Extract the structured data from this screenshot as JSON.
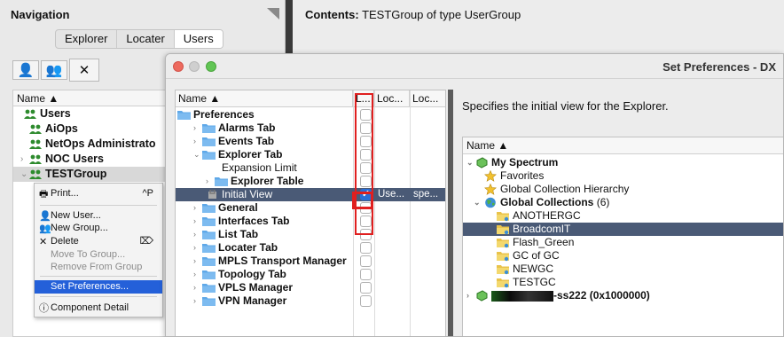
{
  "navigation": {
    "title": "Navigation",
    "tabs": [
      "Explorer",
      "Locater",
      "Users"
    ],
    "active_tab": "Users",
    "tree_header": "Name ▲",
    "items": [
      {
        "label": "Users",
        "indent": 0,
        "arrow": "",
        "selected": false
      },
      {
        "label": "AiOps",
        "indent": 1,
        "arrow": "",
        "selected": false
      },
      {
        "label": "NetOps Administrato",
        "indent": 1,
        "arrow": "",
        "selected": false
      },
      {
        "label": "NOC Users",
        "indent": 1,
        "arrow": "›",
        "selected": false
      },
      {
        "label": "TESTGroup",
        "indent": 1,
        "arrow": "⌄",
        "selected": true
      }
    ]
  },
  "context_menu": {
    "items": [
      {
        "label": "Print...",
        "shortcut": "^P",
        "icon": "printer-icon",
        "enabled": true,
        "highlighted": false
      },
      {
        "label": "New User...",
        "shortcut": "",
        "icon": "user-icon",
        "enabled": true,
        "highlighted": false
      },
      {
        "label": "New Group...",
        "shortcut": "",
        "icon": "group-icon",
        "enabled": true,
        "highlighted": false
      },
      {
        "label": "Delete",
        "shortcut": "⌦",
        "icon": "delete-icon",
        "enabled": true,
        "highlighted": false
      },
      {
        "label": "Move To Group...",
        "shortcut": "",
        "icon": "",
        "enabled": false,
        "highlighted": false
      },
      {
        "label": "Remove From Group",
        "shortcut": "",
        "icon": "",
        "enabled": false,
        "highlighted": false
      },
      {
        "label": "Set Preferences...",
        "shortcut": "",
        "icon": "",
        "enabled": true,
        "highlighted": true
      },
      {
        "label": "Component Detail",
        "shortcut": "",
        "icon": "info-icon",
        "enabled": true,
        "highlighted": false
      }
    ]
  },
  "contents": {
    "label": "Contents:",
    "value": "TESTGroup of type UserGroup"
  },
  "dialog": {
    "title": "Set Preferences - DX",
    "table_headers": [
      "Name ▲",
      "L...",
      "Loc...",
      "Loc..."
    ],
    "rows": [
      {
        "label": "Preferences",
        "level": 0,
        "arrow": "",
        "folder": true,
        "leaf": false,
        "checked": false,
        "loc": "",
        "loc2": "",
        "selected": false
      },
      {
        "label": "Alarms Tab",
        "level": 1,
        "arrow": "›",
        "folder": true,
        "leaf": false,
        "checked": false,
        "loc": "",
        "loc2": "",
        "selected": false
      },
      {
        "label": "Events Tab",
        "level": 1,
        "arrow": "›",
        "folder": true,
        "leaf": false,
        "checked": false,
        "loc": "",
        "loc2": "",
        "selected": false
      },
      {
        "label": "Explorer Tab",
        "level": 1,
        "arrow": "⌄",
        "folder": true,
        "leaf": false,
        "checked": false,
        "loc": "",
        "loc2": "",
        "selected": false
      },
      {
        "label": "Expansion Limit",
        "level": 2,
        "arrow": "",
        "folder": false,
        "leaf": true,
        "checked": false,
        "loc": "",
        "loc2": "",
        "selected": false
      },
      {
        "label": "Explorer Table",
        "level": 2,
        "arrow": "›",
        "folder": true,
        "leaf": false,
        "checked": false,
        "loc": "",
        "loc2": "",
        "selected": false
      },
      {
        "label": "Initial View",
        "level": 2,
        "arrow": "",
        "folder": false,
        "leaf": true,
        "checked": true,
        "loc": "Use...",
        "loc2": "spe...",
        "selected": true
      },
      {
        "label": "General",
        "level": 1,
        "arrow": "›",
        "folder": true,
        "leaf": false,
        "checked": false,
        "loc": "",
        "loc2": "",
        "selected": false
      },
      {
        "label": "Interfaces Tab",
        "level": 1,
        "arrow": "›",
        "folder": true,
        "leaf": false,
        "checked": false,
        "loc": "",
        "loc2": "",
        "selected": false
      },
      {
        "label": "List Tab",
        "level": 1,
        "arrow": "›",
        "folder": true,
        "leaf": false,
        "checked": false,
        "loc": "",
        "loc2": "",
        "selected": false
      },
      {
        "label": "Locater Tab",
        "level": 1,
        "arrow": "›",
        "folder": true,
        "leaf": false,
        "checked": false,
        "loc": "",
        "loc2": "",
        "selected": false
      },
      {
        "label": "MPLS Transport Manager",
        "level": 1,
        "arrow": "›",
        "folder": true,
        "leaf": false,
        "checked": false,
        "loc": "",
        "loc2": "",
        "selected": false
      },
      {
        "label": "Topology Tab",
        "level": 1,
        "arrow": "›",
        "folder": true,
        "leaf": false,
        "checked": false,
        "loc": "",
        "loc2": "",
        "selected": false
      },
      {
        "label": "VPLS Manager",
        "level": 1,
        "arrow": "›",
        "folder": true,
        "leaf": false,
        "checked": false,
        "loc": "",
        "loc2": "",
        "selected": false
      },
      {
        "label": "VPN Manager",
        "level": 1,
        "arrow": "›",
        "folder": true,
        "leaf": false,
        "checked": false,
        "loc": "",
        "loc2": "",
        "selected": false
      }
    ],
    "description": "Specifies the initial view for the Explorer.",
    "view_tree_header": "Name ▲",
    "view_tree": [
      {
        "label": "My Spectrum",
        "level": 0,
        "arrow": "⌄",
        "icon": "spectrum",
        "bold": true,
        "selected": false
      },
      {
        "label": "Favorites",
        "level": 1,
        "arrow": "",
        "icon": "star",
        "bold": false,
        "selected": false
      },
      {
        "label": "Global Collection Hierarchy",
        "level": 1,
        "arrow": "",
        "icon": "star",
        "bold": false,
        "selected": false
      },
      {
        "label": "Global Collections",
        "count": "(6)",
        "level": 1,
        "arrow": "⌄",
        "icon": "globe",
        "bold": true,
        "selected": false
      },
      {
        "label": "ANOTHERGC",
        "level": 2,
        "arrow": "",
        "icon": "folder",
        "bold": false,
        "selected": false
      },
      {
        "label": "BroadcomIT",
        "level": 2,
        "arrow": "",
        "icon": "folder",
        "bold": false,
        "selected": true
      },
      {
        "label": "Flash_Green",
        "level": 2,
        "arrow": "",
        "icon": "folder",
        "bold": false,
        "selected": false
      },
      {
        "label": "GC of GC",
        "level": 2,
        "arrow": "",
        "icon": "folder",
        "bold": false,
        "selected": false
      },
      {
        "label": "NEWGC",
        "level": 2,
        "arrow": "",
        "icon": "folder",
        "bold": false,
        "selected": false
      },
      {
        "label": "TESTGC",
        "level": 2,
        "arrow": "",
        "icon": "folder",
        "bold": false,
        "selected": false
      },
      {
        "label": "-ss222 (0x1000000)",
        "level": 0,
        "arrow": "›",
        "icon": "spectrum",
        "bold": true,
        "selected": false,
        "redacted": true
      }
    ]
  },
  "colors": {
    "selection": "#4a5a76",
    "highlight_annotation": "#e01f1f",
    "menu_highlight": "#2460d9",
    "user_icon": "#2e8b2e"
  }
}
